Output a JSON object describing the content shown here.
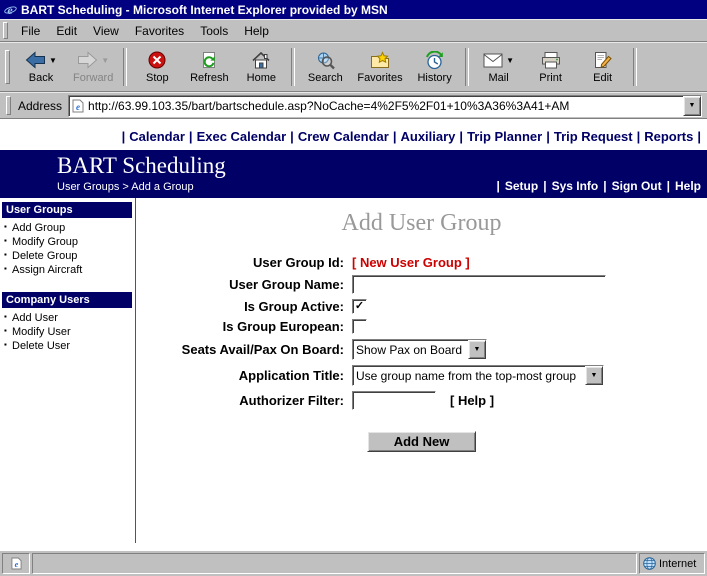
{
  "window": {
    "title": "BART Scheduling - Microsoft Internet Explorer provided by MSN"
  },
  "menubar": {
    "items": [
      "File",
      "Edit",
      "View",
      "Favorites",
      "Tools",
      "Help"
    ]
  },
  "toolbar": {
    "buttons": [
      {
        "label": "Back"
      },
      {
        "label": "Forward"
      },
      {
        "label": "Stop"
      },
      {
        "label": "Refresh"
      },
      {
        "label": "Home"
      },
      {
        "label": "Search"
      },
      {
        "label": "Favorites"
      },
      {
        "label": "History"
      },
      {
        "label": "Mail"
      },
      {
        "label": "Print"
      },
      {
        "label": "Edit"
      }
    ]
  },
  "addressbar": {
    "label": "Address",
    "url": "http://63.99.103.35/bart/bartschedule.asp?NoCache=4%2F5%2F01+10%3A36%3A41+AM"
  },
  "topnav": {
    "separator": "|",
    "items": [
      "Calendar",
      "Exec Calendar",
      "Crew Calendar",
      "Auxiliary",
      "Trip Planner",
      "Trip Request",
      "Reports"
    ]
  },
  "banner": {
    "title": "BART Scheduling",
    "breadcrumb": "User Groups > Add a Group",
    "separator": "|",
    "links": [
      "Setup",
      "Sys Info",
      "Sign Out",
      "Help"
    ]
  },
  "sidebar": {
    "sections": [
      {
        "title": "User Groups",
        "items": [
          "Add Group",
          "Modify Group",
          "Delete Group",
          "Assign Aircraft"
        ]
      },
      {
        "title": "Company Users",
        "items": [
          "Add User",
          "Modify User",
          "Delete User"
        ]
      }
    ]
  },
  "form": {
    "title": "Add User Group",
    "user_group_id": {
      "label": "User Group Id:",
      "value": "[ New User Group ]"
    },
    "user_group_name": {
      "label": "User Group Name:",
      "value": ""
    },
    "is_group_active": {
      "label": "Is Group Active:",
      "checked": true,
      "mark": "✓"
    },
    "is_group_european": {
      "label": "Is Group European:",
      "checked": false,
      "mark": ""
    },
    "seats": {
      "label": "Seats Avail/Pax On Board:",
      "value": "Show Pax on Board"
    },
    "application_title": {
      "label": "Application Title:",
      "value": "Use group name from the top-most group"
    },
    "authorizer": {
      "label": "Authorizer Filter:",
      "value": "",
      "help": "[ Help ]"
    },
    "submit_label": "Add New"
  },
  "statusbar": {
    "zone": "Internet"
  }
}
